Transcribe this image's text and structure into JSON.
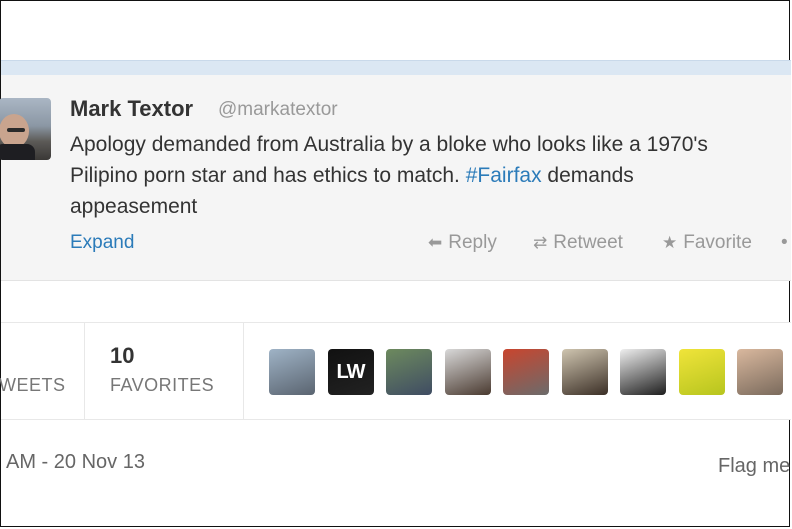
{
  "tweet": {
    "author_name": "Mark Textor",
    "handle": "@markatextor",
    "text_line1": "Apology demanded from Australia by a bloke who looks like a 1970's",
    "text_line2_before": "Pilipino porn star and has ethics to match. ",
    "hashtag": "#Fairfax",
    "text_line2_after": " demands",
    "text_line3": "appeasement",
    "expand_label": "Expand",
    "actions": {
      "reply": "Reply",
      "retweet": "Retweet",
      "favorite": "Favorite",
      "more": "•"
    }
  },
  "stats": {
    "retweets_label": "WEETS",
    "favorites_count": "10",
    "favorites_label": "FAVORITES",
    "favoriter_avatars": [
      {
        "name": "avatar-plane",
        "colors": [
          "#9fb3c6",
          "#5a6470"
        ]
      },
      {
        "name": "avatar-lw",
        "text": "LW",
        "colors": [
          "#111111",
          "#222222"
        ]
      },
      {
        "name": "avatar-couple",
        "colors": [
          "#6d8a5e",
          "#3f4c63"
        ]
      },
      {
        "name": "avatar-grey-hair",
        "colors": [
          "#d9d9d9",
          "#4a3a30"
        ]
      },
      {
        "name": "avatar-red-car",
        "colors": [
          "#c9452e",
          "#6b6b6b"
        ]
      },
      {
        "name": "avatar-sepia-portrait",
        "colors": [
          "#cfc5b0",
          "#3b2f26"
        ]
      },
      {
        "name": "avatar-bw-portrait",
        "colors": [
          "#efefef",
          "#1e1e1e"
        ]
      },
      {
        "name": "avatar-yellow-face",
        "colors": [
          "#f0e43a",
          "#b7c51e"
        ]
      },
      {
        "name": "avatar-man-smiling",
        "colors": [
          "#d9b89e",
          "#7a6a5c"
        ]
      }
    ]
  },
  "footer": {
    "timestamp": "AM - 20 Nov 13",
    "flag_label": "Flag me"
  },
  "colors": {
    "link_blue": "#2b7bb9",
    "card_bg": "#f5f5f5",
    "muted": "#999999"
  }
}
